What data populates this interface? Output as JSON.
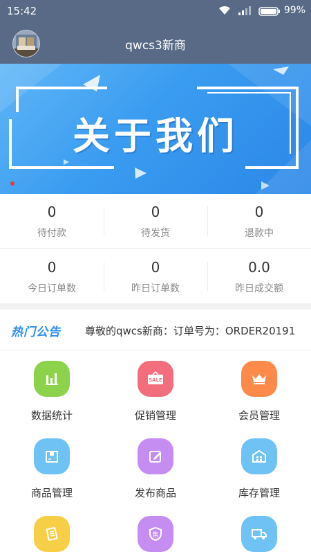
{
  "status_bar": {
    "time": "15:42",
    "battery": "99%"
  },
  "header": {
    "title": "qwcs3新商"
  },
  "banner": {
    "text": "关于我们"
  },
  "stats": [
    {
      "value": "0",
      "label": "待付款"
    },
    {
      "value": "0",
      "label": "待发货"
    },
    {
      "value": "0",
      "label": "退款中"
    },
    {
      "value": "0",
      "label": "今日订单数"
    },
    {
      "value": "0",
      "label": "昨日订单数"
    },
    {
      "value": "0.0",
      "label": "昨日成交额"
    }
  ],
  "notice": {
    "tag": "热门公告",
    "text": "尊敬的qwcs新商：订单号为：ORDER20191"
  },
  "menu": [
    {
      "label": "数据统计",
      "icon": "bar-chart-icon",
      "color": "#8dd24b"
    },
    {
      "label": "促销管理",
      "icon": "sale-tag-icon",
      "color": "#f36e7d"
    },
    {
      "label": "会员管理",
      "icon": "crown-icon",
      "color": "#fd8a4b"
    },
    {
      "label": "商品管理",
      "icon": "box-icon",
      "color": "#6ec3f4"
    },
    {
      "label": "发布商品",
      "icon": "edit-icon",
      "color": "#c58cf1"
    },
    {
      "label": "库存管理",
      "icon": "warehouse-icon",
      "color": "#6ec3f4"
    },
    {
      "label": "",
      "icon": "document-icon",
      "color": "#f6cf47"
    },
    {
      "label": "",
      "icon": "shield-sale-icon",
      "color": "#c58cf1"
    },
    {
      "label": "",
      "icon": "truck-icon",
      "color": "#6ec3f4"
    }
  ]
}
